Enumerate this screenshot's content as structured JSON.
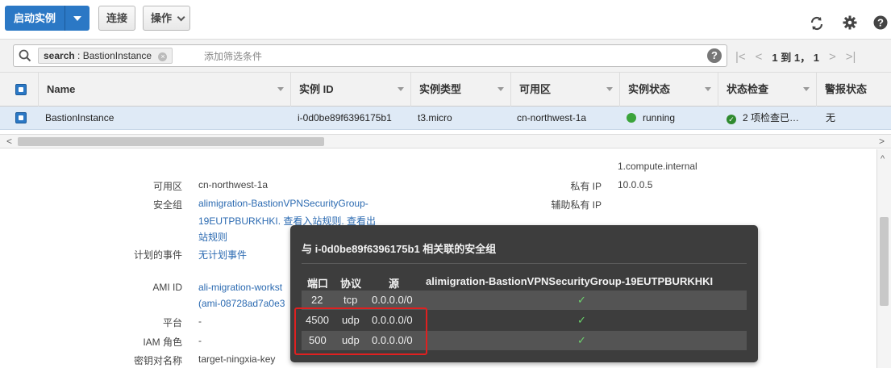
{
  "toolbar": {
    "launch_label": "启动实例",
    "connect_label": "连接",
    "actions_label": "操作"
  },
  "filter": {
    "token_key": "search",
    "token_value": "BastionInstance",
    "placeholder": "添加筛选条件",
    "pager_text": "1 到 1， 1"
  },
  "table": {
    "columns": [
      "Name",
      "实例 ID",
      "实例类型",
      "可用区",
      "实例状态",
      "状态检查",
      "警报状态"
    ],
    "row": {
      "name": "BastionInstance",
      "instance_id": "i-0d0be89f6396175b1",
      "instance_type": "t3.micro",
      "az": "cn-northwest-1a",
      "state": "running",
      "status_check": "2 项检查已…",
      "alarm": "无"
    }
  },
  "details": {
    "az_label": "可用区",
    "az_value": "cn-northwest-1a",
    "sg_label": "安全组",
    "sg_value_line1": "alimigration-BastionVPNSecurityGroup-",
    "sg_value_line2": "19EUTPBURKHKI. 查看入站规则. 查看出",
    "sg_value_line3": "站规则",
    "events_label": "计划的事件",
    "events_value": "无计划事件",
    "ami_label": "AMI ID",
    "ami_value_line1": "ali-migration-workst",
    "ami_value_line2": "(ami-08728ad7a0e3",
    "platform_label": "平台",
    "platform_value": "-",
    "iam_label": "IAM 角色",
    "iam_value": "-",
    "key_label": "密钥对名称",
    "key_value": "target-ningxia-key",
    "dns_tail": "1.compute.internal",
    "private_ip_label": "私有 IP",
    "private_ip_value": "10.0.0.5",
    "secondary_ip_label": "辅助私有 IP"
  },
  "popup": {
    "title": "与 i-0d0be89f6396175b1 相关联的安全组",
    "col_port": "端口",
    "col_protocol": "协议",
    "col_source": "源",
    "col_group": "alimigration-BastionVPNSecurityGroup-19EUTPBURKHKI",
    "rules": [
      {
        "port": "22",
        "protocol": "tcp",
        "source": "0.0.0.0/0",
        "check": "✓"
      },
      {
        "port": "4500",
        "protocol": "udp",
        "source": "0.0.0.0/0",
        "check": "✓"
      },
      {
        "port": "500",
        "protocol": "udp",
        "source": "0.0.0.0/0",
        "check": "✓"
      }
    ]
  },
  "colors": {
    "primary": "#2b78c5",
    "row_selected": "#dfeaf6",
    "running": "#3ba43b",
    "highlight": "#e02020"
  }
}
